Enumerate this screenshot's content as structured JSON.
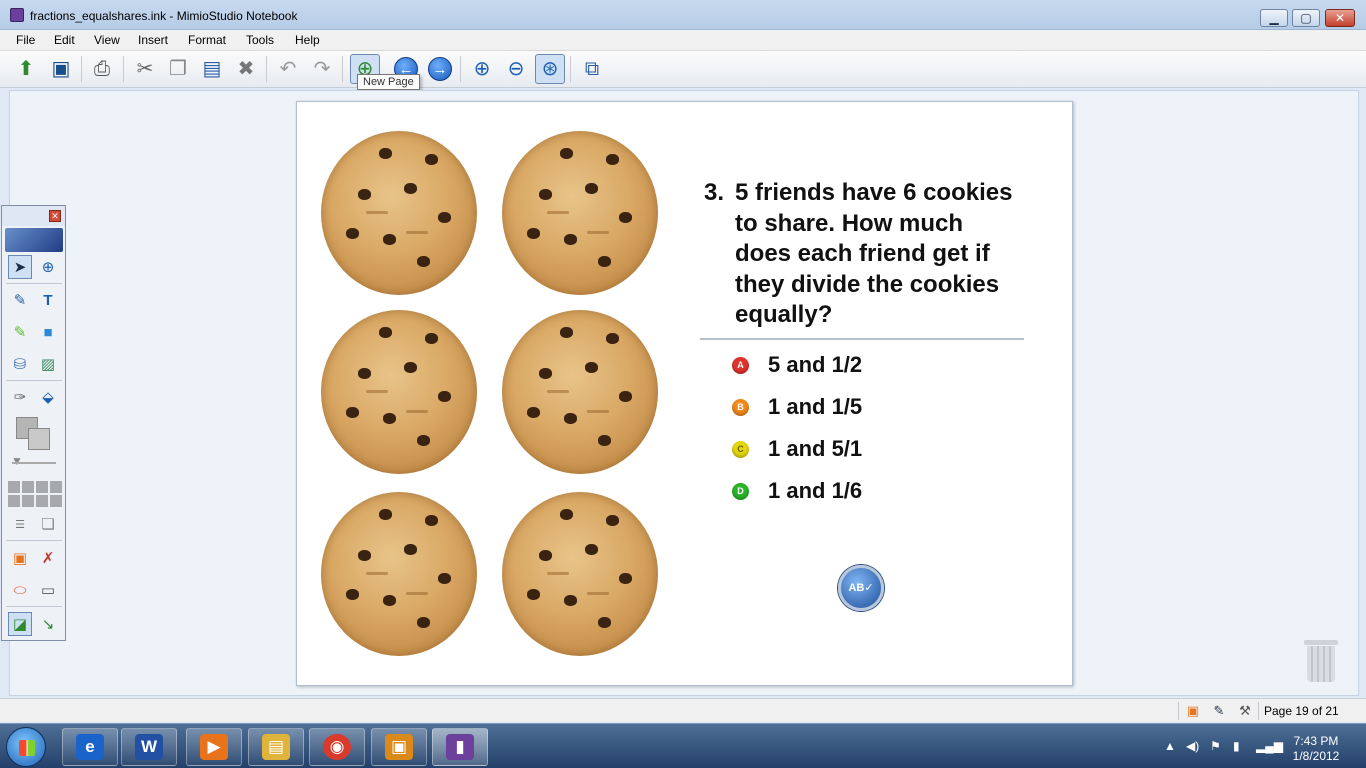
{
  "window": {
    "title": "fractions_equalshares.ink - MimioStudio Notebook",
    "min_glyph": "▁",
    "max_glyph": "▢",
    "close_glyph": "✕"
  },
  "menu": [
    "File",
    "Edit",
    "View",
    "Insert",
    "Format",
    "Tools",
    "Help"
  ],
  "toolbar": {
    "tooltip": "New Page",
    "back_glyph": "←",
    "forward_glyph": "→"
  },
  "question": {
    "number": "3.",
    "text": "5 friends have 6 cookies to share. How much does each friend get if they divide the cookies equally?"
  },
  "answers": [
    {
      "letter": "A",
      "text": "5 and 1/2",
      "color": "#e0332b"
    },
    {
      "letter": "B",
      "text": "1 and 1/5",
      "color": "#f08a1a"
    },
    {
      "letter": "C",
      "text": "1 and 5/1",
      "color": "#e5d612"
    },
    {
      "letter": "D",
      "text": "1 and 1/6",
      "color": "#2bb52b"
    }
  ],
  "vote_button": {
    "label": "AB✓"
  },
  "palette": {
    "close_glyph": "✕"
  },
  "status": {
    "page": "Page 19 of 21"
  },
  "taskbar": {
    "time": "7:43 PM",
    "date": "1/8/2012",
    "apps": [
      {
        "glyph": "e",
        "color": "#1a63c9"
      },
      {
        "glyph": "W",
        "color": "#2251a3"
      },
      {
        "glyph": "▶",
        "color": "#e8731b"
      },
      {
        "glyph": "▤",
        "color": "#e0b33a"
      },
      {
        "glyph": "◉",
        "color": "#d93a2b"
      },
      {
        "glyph": "▣",
        "color": "#d98a1a"
      },
      {
        "glyph": "▮",
        "color": "#6b3f9c"
      }
    ]
  },
  "colors": {
    "accent": "#1557b8",
    "page_bg": "#ffffff",
    "workspace_bg": "#eef3f9"
  }
}
